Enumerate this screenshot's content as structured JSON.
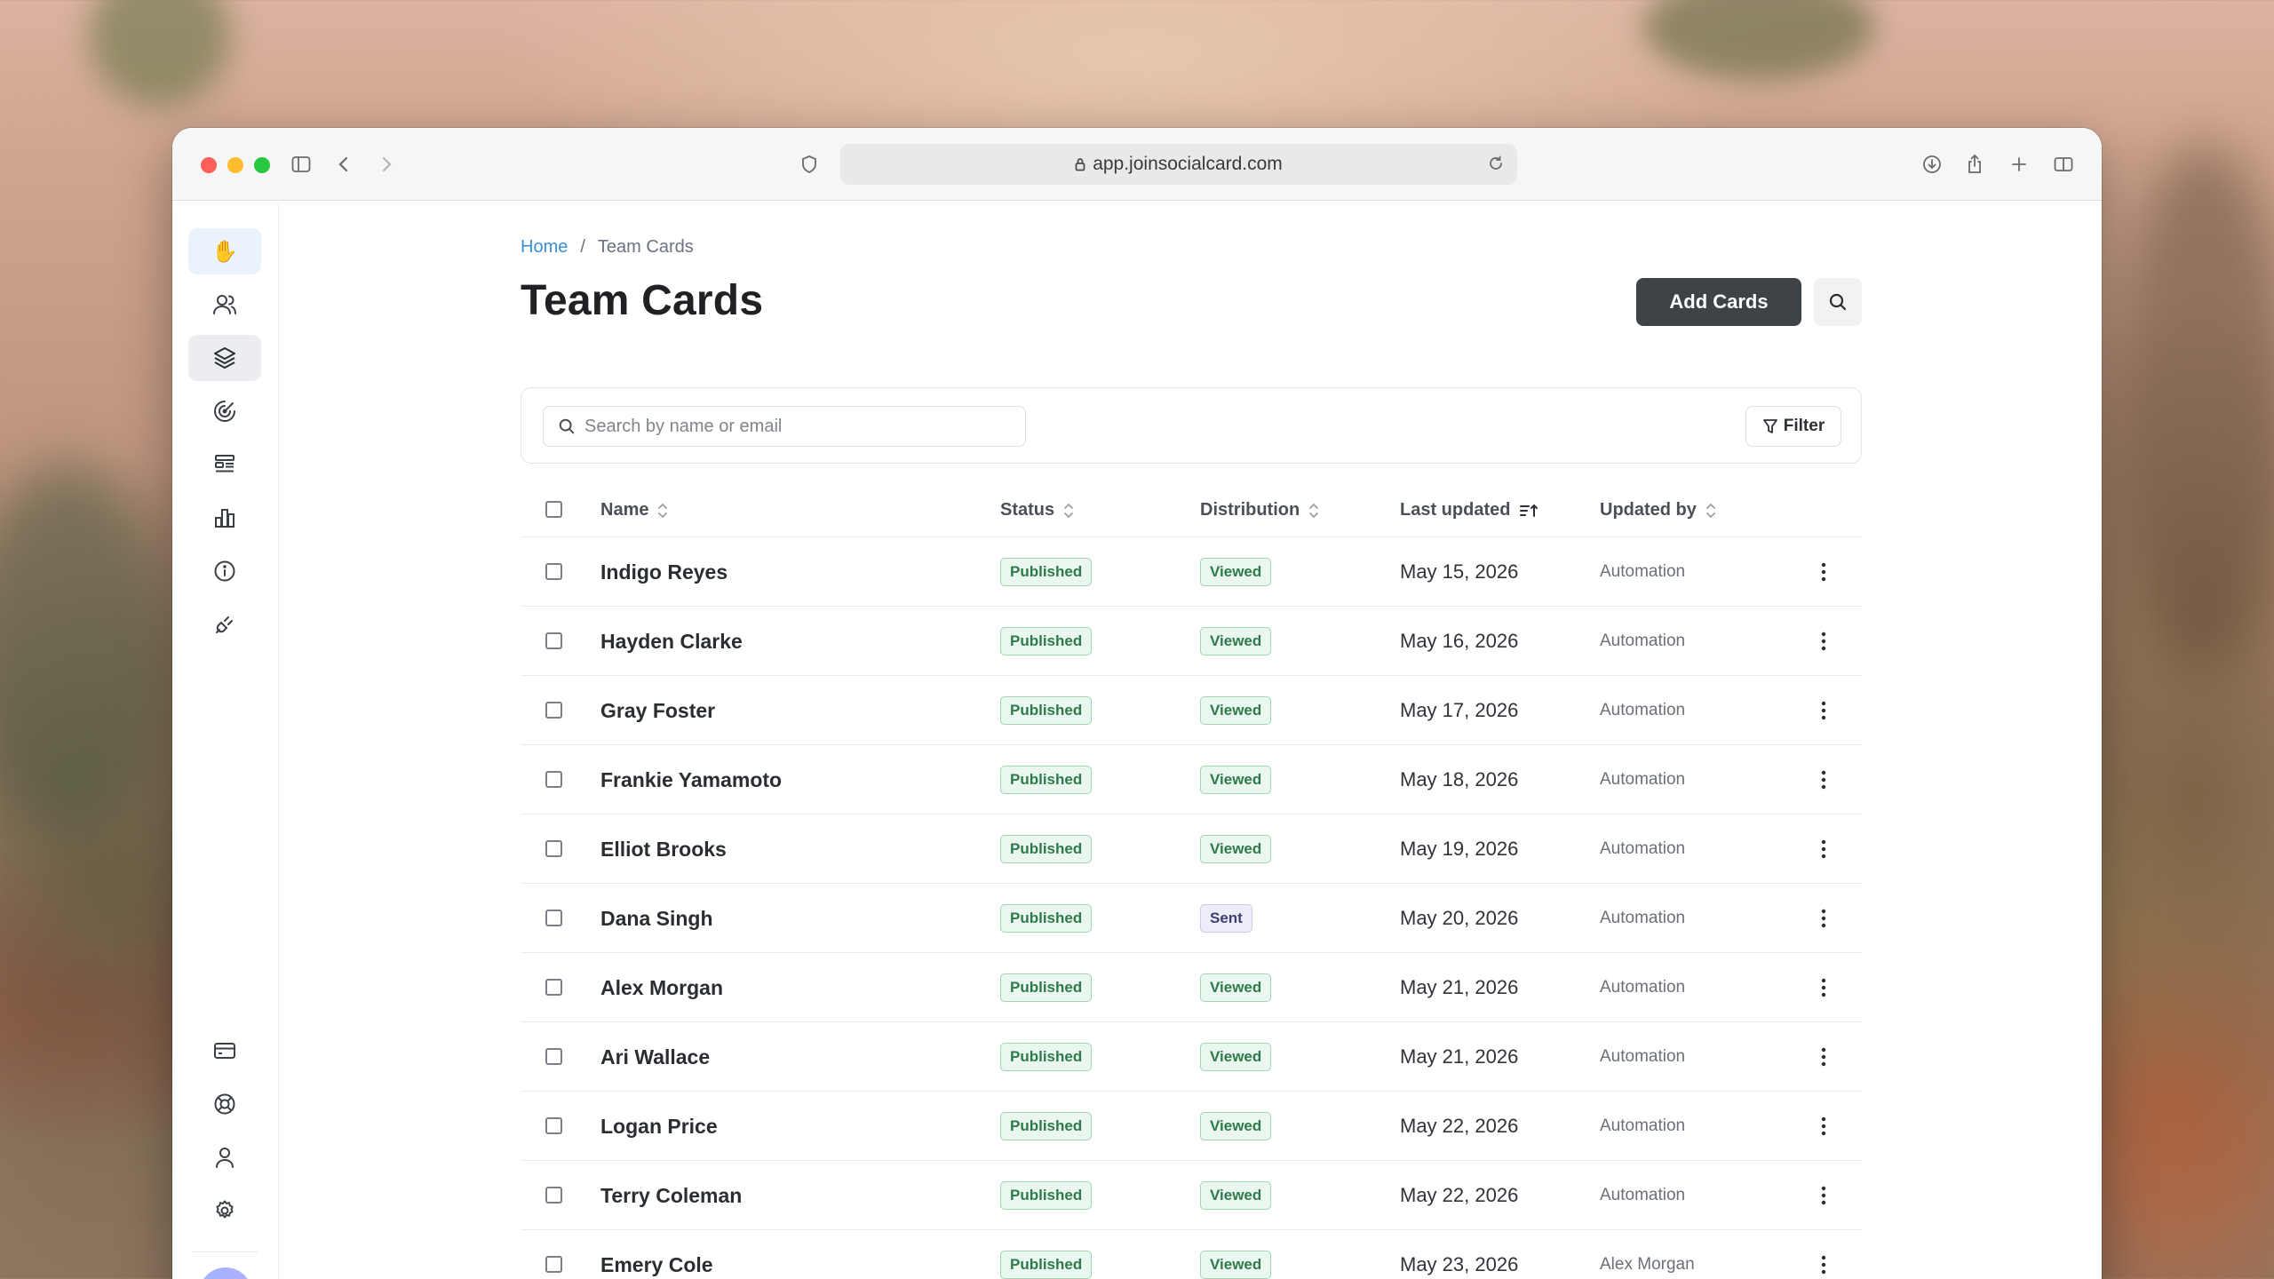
{
  "browser": {
    "url": "app.joinsocialcard.com"
  },
  "sidebar": {
    "items": [
      {
        "icon": "waving-hand-icon"
      },
      {
        "icon": "users-icon"
      },
      {
        "icon": "layers-icon"
      },
      {
        "icon": "radar-icon"
      },
      {
        "icon": "layout-icon"
      },
      {
        "icon": "bar-chart-icon"
      },
      {
        "icon": "info-icon"
      },
      {
        "icon": "plug-icon"
      },
      {
        "icon": "credit-card-icon"
      },
      {
        "icon": "lifebuoy-icon"
      },
      {
        "icon": "user-icon"
      },
      {
        "icon": "gear-icon"
      }
    ]
  },
  "breadcrumb": {
    "home": "Home",
    "separator": "/",
    "current": "Team Cards"
  },
  "page": {
    "title": "Team Cards",
    "add_button": "Add Cards"
  },
  "search": {
    "placeholder": "Search by name or email",
    "filter_label": "Filter"
  },
  "table": {
    "columns": {
      "name": "Name",
      "status": "Status",
      "distribution": "Distribution",
      "last_updated": "Last updated",
      "updated_by": "Updated by"
    },
    "rows": [
      {
        "name": "Indigo Reyes",
        "status": "Published",
        "distribution": "Viewed",
        "last_updated": "May 15, 2026",
        "updated_by": "Automation"
      },
      {
        "name": "Hayden Clarke",
        "status": "Published",
        "distribution": "Viewed",
        "last_updated": "May 16, 2026",
        "updated_by": "Automation"
      },
      {
        "name": "Gray Foster",
        "status": "Published",
        "distribution": "Viewed",
        "last_updated": "May 17, 2026",
        "updated_by": "Automation"
      },
      {
        "name": "Frankie Yamamoto",
        "status": "Published",
        "distribution": "Viewed",
        "last_updated": "May 18, 2026",
        "updated_by": "Automation"
      },
      {
        "name": "Elliot Brooks",
        "status": "Published",
        "distribution": "Viewed",
        "last_updated": "May 19, 2026",
        "updated_by": "Automation"
      },
      {
        "name": "Dana Singh",
        "status": "Published",
        "distribution": "Sent",
        "last_updated": "May 20, 2026",
        "updated_by": "Automation"
      },
      {
        "name": "Alex Morgan",
        "status": "Published",
        "distribution": "Viewed",
        "last_updated": "May 21, 2026",
        "updated_by": "Automation"
      },
      {
        "name": "Ari Wallace",
        "status": "Published",
        "distribution": "Viewed",
        "last_updated": "May 21, 2026",
        "updated_by": "Automation"
      },
      {
        "name": "Logan Price",
        "status": "Published",
        "distribution": "Viewed",
        "last_updated": "May 22, 2026",
        "updated_by": "Automation"
      },
      {
        "name": "Terry Coleman",
        "status": "Published",
        "distribution": "Viewed",
        "last_updated": "May 22, 2026",
        "updated_by": "Automation"
      },
      {
        "name": "Emery Cole",
        "status": "Published",
        "distribution": "Viewed",
        "last_updated": "May 23, 2026",
        "updated_by": "Alex Morgan"
      }
    ]
  },
  "colors": {
    "primary_button": "#3e4348",
    "link": "#3a8fd6",
    "badge_green": "#2f7a4c",
    "badge_purple": "#3d3f73"
  }
}
